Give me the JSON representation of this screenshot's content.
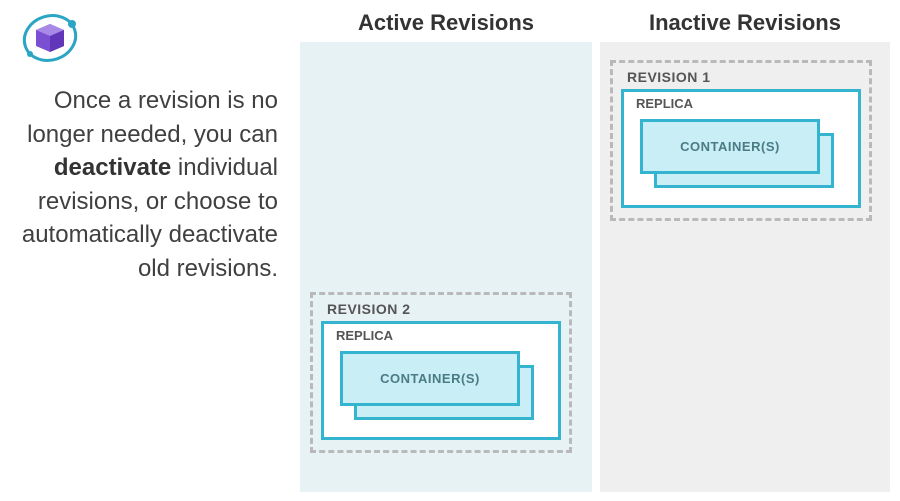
{
  "description": {
    "pre": "Once a revision is no longer needed, you can ",
    "bold": "deactivate",
    "post": " individual revisions, or choose to automatically deactivate old revisions."
  },
  "columns": {
    "active": {
      "title": "Active Revisions"
    },
    "inactive": {
      "title": "Inactive Revisions"
    }
  },
  "revisions": {
    "rev1": {
      "label": "REVISION 1",
      "replica_label": "REPLICA",
      "container_label": "CONTAINER(S)"
    },
    "rev2": {
      "label": "REVISION 2",
      "replica_label": "REPLICA",
      "container_label": "CONTAINER(S)"
    }
  },
  "colors": {
    "active_bg": "#e7f2f5",
    "inactive_bg": "#efefef",
    "accent": "#35b4cf",
    "container_fill": "#c9eef5"
  }
}
